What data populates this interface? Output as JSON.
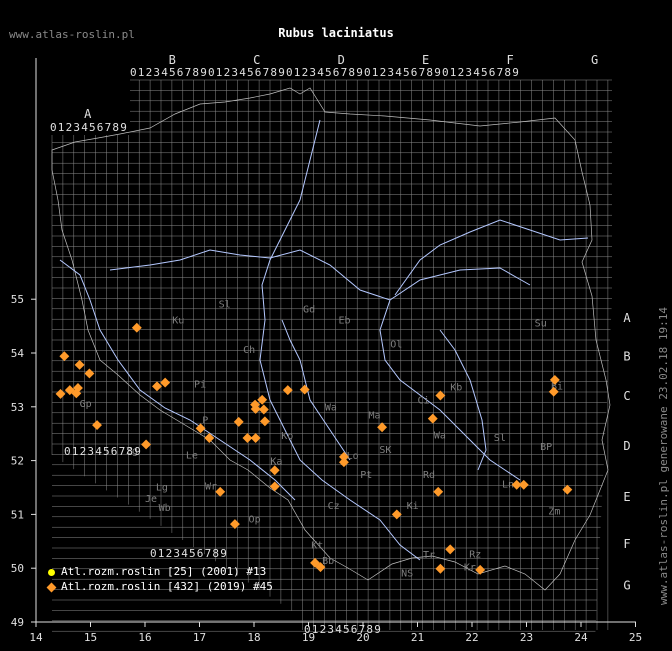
{
  "site_label": "www.atlas-roslin.pl",
  "title": "Rubus laciniatus",
  "side_label": "www.atlas-roslin.pl generowane 23.02.18 19:14",
  "axes": {
    "x_ticks": [
      "14",
      "15",
      "16",
      "17",
      "18",
      "19",
      "20",
      "21",
      "22",
      "23",
      "24",
      "25"
    ],
    "y_ticks": [
      "55",
      "54",
      "53",
      "52",
      "51",
      "50",
      "49"
    ],
    "x_range": [
      14,
      25
    ],
    "y_range": [
      49,
      55.6
    ]
  },
  "colors": {
    "background": "#000000",
    "grid": "#8c8c8c",
    "rivers": "#b4c8ff",
    "border": "#bfbfbf",
    "series_2001": "#ffff00",
    "series_2019": "#ff9a2a"
  },
  "grid_letters": {
    "top": [
      {
        "t": "A",
        "lon": 14.95
      },
      {
        "t": "B",
        "lon": 16.5
      },
      {
        "t": "C",
        "lon": 18.05
      },
      {
        "t": "D",
        "lon": 19.6
      },
      {
        "t": "E",
        "lon": 21.15
      },
      {
        "t": "F",
        "lon": 22.7
      },
      {
        "t": "G",
        "lon": 24.25
      }
    ],
    "right": [
      {
        "t": "A",
        "lat": 54.58
      },
      {
        "t": "B",
        "lat": 53.86
      },
      {
        "t": "C",
        "lat": 53.13
      },
      {
        "t": "D",
        "lat": 52.2
      },
      {
        "t": "E",
        "lat": 51.25
      },
      {
        "t": "F",
        "lat": 50.38
      },
      {
        "t": "G",
        "lat": 49.6
      }
    ]
  },
  "digit_strip": "0123456789",
  "region_labels": [
    {
      "t": "Ku",
      "lon": 16.5,
      "lat": 54.55
    },
    {
      "t": "Sl",
      "lon": 17.35,
      "lat": 54.85
    },
    {
      "t": "Gd",
      "lon": 18.9,
      "lat": 54.75
    },
    {
      "t": "Eb",
      "lon": 19.55,
      "lat": 54.55
    },
    {
      "t": "Su",
      "lon": 23.15,
      "lat": 54.49
    },
    {
      "t": "Ch",
      "lon": 17.8,
      "lat": 54.0
    },
    {
      "t": "Ol",
      "lon": 20.5,
      "lat": 54.1
    },
    {
      "t": "Pi",
      "lon": 16.9,
      "lat": 53.36
    },
    {
      "t": "Ci",
      "lon": 21.0,
      "lat": 53.06
    },
    {
      "t": "Bi",
      "lon": 23.45,
      "lat": 53.32
    },
    {
      "t": "Kb",
      "lon": 21.6,
      "lat": 53.3
    },
    {
      "t": "Gp",
      "lon": 14.8,
      "lat": 53.0
    },
    {
      "t": "Wa",
      "lon": 19.3,
      "lat": 52.93
    },
    {
      "t": "Ma",
      "lon": 20.1,
      "lat": 52.78
    },
    {
      "t": "P",
      "lon": 17.05,
      "lat": 52.69
    },
    {
      "t": "Ko",
      "lon": 18.5,
      "lat": 52.4
    },
    {
      "t": "Wa",
      "lon": 21.3,
      "lat": 52.41
    },
    {
      "t": "Sl",
      "lon": 22.4,
      "lat": 52.36
    },
    {
      "t": "BP",
      "lon": 23.25,
      "lat": 52.2
    },
    {
      "t": "Zg",
      "lon": 15.65,
      "lat": 52.12
    },
    {
      "t": "Le",
      "lon": 16.75,
      "lat": 52.04
    },
    {
      "t": "Lo",
      "lon": 19.7,
      "lat": 52.03
    },
    {
      "t": "Ka",
      "lon": 18.3,
      "lat": 51.93
    },
    {
      "t": "SK",
      "lon": 20.3,
      "lat": 52.14
    },
    {
      "t": "Pt",
      "lon": 19.95,
      "lat": 51.68
    },
    {
      "t": "Rd",
      "lon": 21.1,
      "lat": 51.68
    },
    {
      "t": "Ln",
      "lon": 22.55,
      "lat": 51.5
    },
    {
      "t": "Lg",
      "lon": 16.2,
      "lat": 51.44
    },
    {
      "t": "Wr",
      "lon": 17.1,
      "lat": 51.46
    },
    {
      "t": "Je",
      "lon": 16.0,
      "lat": 51.23
    },
    {
      "t": "Wb",
      "lon": 16.25,
      "lat": 51.06
    },
    {
      "t": "Cz",
      "lon": 19.35,
      "lat": 51.1
    },
    {
      "t": "Ki",
      "lon": 20.8,
      "lat": 51.1
    },
    {
      "t": "Zm",
      "lon": 23.4,
      "lat": 51.0
    },
    {
      "t": "Op",
      "lon": 17.9,
      "lat": 50.85
    },
    {
      "t": "Kt",
      "lon": 19.05,
      "lat": 50.37
    },
    {
      "t": "Tr",
      "lon": 21.1,
      "lat": 50.19
    },
    {
      "t": "Rz",
      "lon": 21.95,
      "lat": 50.2
    },
    {
      "t": "Bb",
      "lon": 19.25,
      "lat": 50.08
    },
    {
      "t": "NS",
      "lon": 20.7,
      "lat": 49.85
    },
    {
      "t": "Kr",
      "lon": 21.85,
      "lat": 49.96
    }
  ],
  "legend": [
    {
      "label": "Atl.rozm.roslin [25] (2001) #13"
    },
    {
      "label": "Atl.rozm.roslin [432] (2019) #45"
    }
  ],
  "points_2019": [
    [
      15.85,
      54.47
    ],
    [
      14.52,
      53.94
    ],
    [
      14.8,
      53.78
    ],
    [
      14.98,
      53.62
    ],
    [
      14.77,
      53.35
    ],
    [
      14.62,
      53.31
    ],
    [
      14.74,
      53.25
    ],
    [
      14.45,
      53.24
    ],
    [
      16.22,
      53.38
    ],
    [
      16.37,
      53.45
    ],
    [
      18.62,
      53.31
    ],
    [
      18.93,
      53.32
    ],
    [
      18.15,
      53.13
    ],
    [
      18.02,
      53.04
    ],
    [
      18.18,
      52.95
    ],
    [
      18.03,
      52.96
    ],
    [
      17.72,
      52.72
    ],
    [
      18.2,
      52.73
    ],
    [
      15.12,
      52.66
    ],
    [
      17.02,
      52.6
    ],
    [
      17.18,
      52.42
    ],
    [
      17.88,
      52.42
    ],
    [
      18.03,
      52.42
    ],
    [
      16.02,
      52.3
    ],
    [
      20.35,
      52.62
    ],
    [
      21.28,
      52.78
    ],
    [
      21.42,
      53.21
    ],
    [
      23.52,
      53.5
    ],
    [
      23.5,
      53.28
    ],
    [
      19.65,
      52.07
    ],
    [
      19.65,
      51.97
    ],
    [
      18.38,
      51.82
    ],
    [
      18.38,
      51.52
    ],
    [
      17.38,
      51.42
    ],
    [
      21.38,
      51.42
    ],
    [
      20.62,
      51.0
    ],
    [
      22.82,
      51.55
    ],
    [
      22.95,
      51.55
    ],
    [
      23.75,
      51.46
    ],
    [
      17.65,
      50.82
    ],
    [
      19.12,
      50.1
    ],
    [
      19.22,
      50.02
    ],
    [
      21.6,
      50.35
    ],
    [
      21.42,
      49.99
    ],
    [
      22.15,
      49.97
    ]
  ]
}
